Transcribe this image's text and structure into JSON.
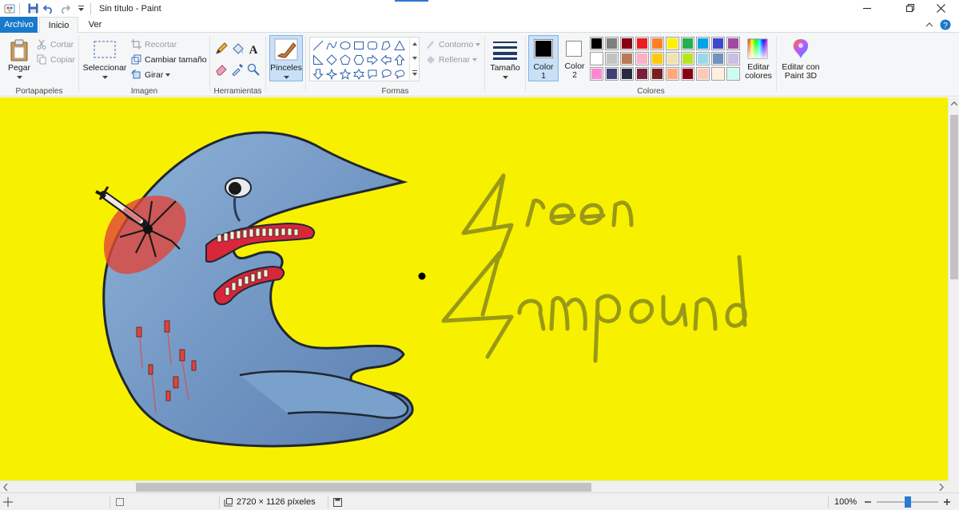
{
  "window": {
    "title": "Sin título - Paint"
  },
  "tabs": [
    {
      "label": "Archivo"
    },
    {
      "label": "Inicio"
    },
    {
      "label": "Ver"
    }
  ],
  "ribbon": {
    "clipboard": {
      "label": "Portapapeles",
      "paste": "Pegar",
      "cut": "Cortar",
      "copy": "Copiar"
    },
    "image": {
      "label": "Imagen",
      "select": "Seleccionar",
      "crop": "Recortar",
      "resize": "Cambiar tamaño",
      "rotate": "Girar"
    },
    "tools": {
      "label": "Herramientas"
    },
    "brushes": {
      "label": "Pinceles"
    },
    "shapes": {
      "label": "Formas",
      "outline": "Contorno",
      "fill": "Rellenar"
    },
    "size": {
      "label": "Tamaño"
    },
    "colors": {
      "label": "Colores",
      "color1_line1": "Color",
      "color1_line2": "1",
      "color2_line1": "Color",
      "color2_line2": "2",
      "edit_line1": "Editar",
      "edit_line2": "colores",
      "paint3d_line1": "Editar con",
      "paint3d_line2": "Paint 3D",
      "color1_value": "#000000",
      "color2_value": "#ffffff",
      "palette_row1": [
        "#000000",
        "#7f7f7f",
        "#880015",
        "#ed1c24",
        "#ff7f27",
        "#fff200",
        "#22b14c",
        "#00a2e8",
        "#3f48cc",
        "#a349a4"
      ],
      "palette_row2": [
        "#ffffff",
        "#c3c3c3",
        "#b97a57",
        "#ffaec9",
        "#ffc90e",
        "#efe4b0",
        "#b5e61d",
        "#99d9ea",
        "#7092be",
        "#c8bfe7"
      ],
      "palette_row3": [
        "#ff86d0",
        "#3f3f74",
        "#2a2a40",
        "#7a1e3a",
        "#7a1e1e",
        "#ffa87c",
        "#880015",
        "#ffc8b4",
        "#fff0dc",
        "#c8fff0"
      ]
    }
  },
  "canvas": {
    "background": "#f7f100",
    "text_line1": "Green",
    "text_line2": "Compound"
  },
  "status": {
    "size_text": "2720 × 1126 píxeles",
    "zoom": "100%",
    "zoom_level": 0.5
  }
}
